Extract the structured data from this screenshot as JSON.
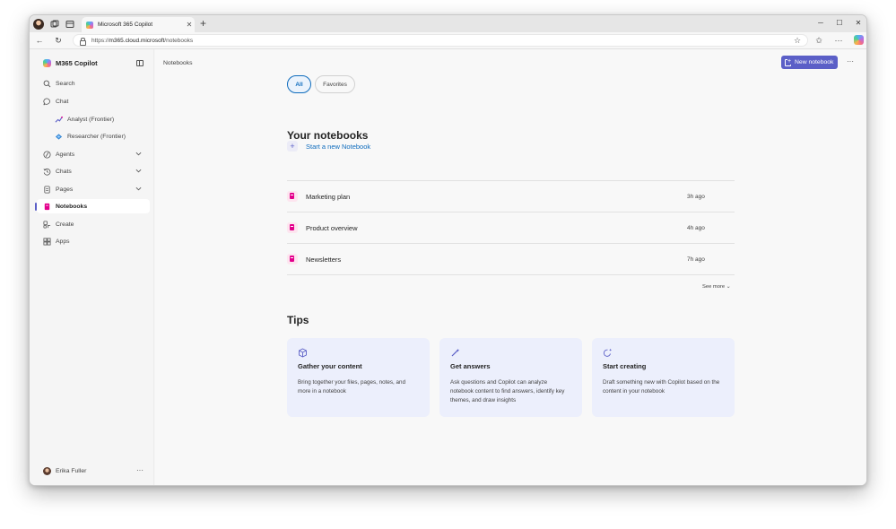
{
  "browser": {
    "tab_title": "Microsoft 365 Copilot",
    "url_prefix": "https://",
    "url_host": "m365.cloud.microsoft",
    "url_path": "/notebooks"
  },
  "sidebar": {
    "brand": "M365 Copilot",
    "items": [
      {
        "label": "Search",
        "icon": "search-icon"
      },
      {
        "label": "Chat",
        "icon": "chat-icon"
      },
      {
        "label": "Analyst (Frontier)",
        "icon": "analyst-icon"
      },
      {
        "label": "Researcher (Frontier)",
        "icon": "researcher-icon"
      },
      {
        "label": "Agents",
        "icon": "agents-icon"
      },
      {
        "label": "Chats",
        "icon": "history-icon"
      },
      {
        "label": "Pages",
        "icon": "pages-icon"
      },
      {
        "label": "Notebooks",
        "icon": "notebook-icon"
      },
      {
        "label": "Create",
        "icon": "create-icon"
      },
      {
        "label": "Apps",
        "icon": "apps-icon"
      }
    ],
    "user_name": "Erika Fuller"
  },
  "main": {
    "breadcrumb": "Notebooks",
    "new_notebook_label": "New notebook",
    "filters": [
      "All",
      "Favorites"
    ],
    "notebooks_heading": "Your notebooks",
    "start_new_label": "Start a new Notebook",
    "notebooks": [
      {
        "title": "Marketing plan",
        "time": "3h ago"
      },
      {
        "title": "Product overview",
        "time": "4h ago"
      },
      {
        "title": "Newsletters",
        "time": "7h ago"
      }
    ],
    "see_more_label": "See more",
    "tips_heading": "Tips",
    "tips": [
      {
        "title": "Gather your content",
        "description": "Bring together your files, pages, notes, and more in a notebook",
        "icon": "cube-icon"
      },
      {
        "title": "Get answers",
        "description": "Ask questions and Copilot can analyze notebook content to find answers, identify key themes, and draw insights",
        "icon": "pen-sparkle-icon"
      },
      {
        "title": "Start creating",
        "description": "Draft something new with Copilot based on the content in your notebook",
        "icon": "refresh-sparkle-icon"
      }
    ]
  },
  "colors": {
    "accent": "#5b5fc7",
    "link": "#0f6cbd",
    "notebook_icon": "#e3008c",
    "tip_card": "#eceffc"
  }
}
